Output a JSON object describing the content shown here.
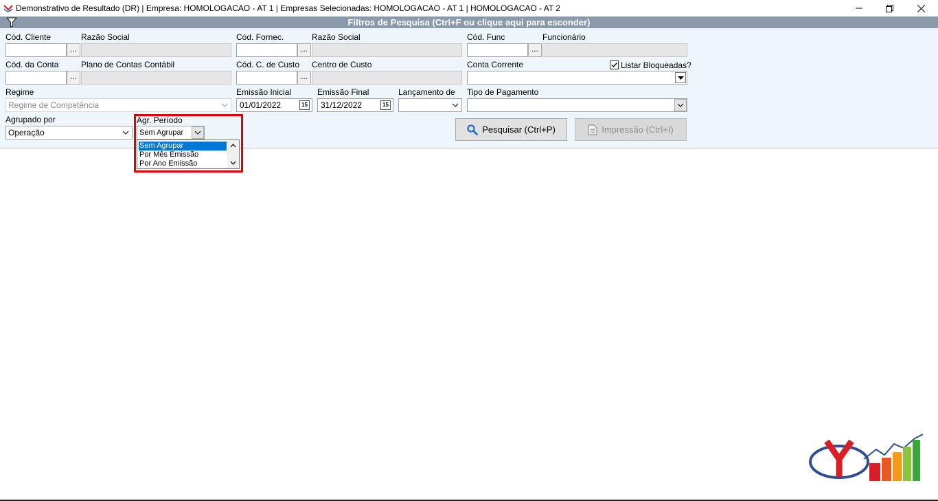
{
  "window": {
    "title": "Demonstrativo de Resultado (DR) | Empresa: HOMOLOGACAO - AT 1 | Empresas Selecionadas: HOMOLOGACAO - AT 1 | HOMOLOGACAO - AT 2"
  },
  "filters": {
    "header": "Filtros de Pesquisa (Ctrl+F ou clique aqui para esconder)",
    "row1": {
      "cod_cliente_label": "Cód. Cliente",
      "razao_social_label": "Razão Social",
      "cod_fornec_label": "Cód. Fornec.",
      "razao_social2_label": "Razão Social",
      "cod_func_label": "Cód. Func",
      "funcionario_label": "Funcionário"
    },
    "row2": {
      "cod_conta_label": "Cód. da Conta",
      "plano_contas_label": "Plano de Contas Contábil",
      "cod_c_custo_label": "Cód. C. de Custo",
      "centro_custo_label": "Centro de Custo",
      "conta_corrente_label": "Conta Corrente",
      "listar_bloqueadas_label": "Listar Bloqueadas?",
      "listar_bloqueadas_checked": true
    },
    "row3": {
      "regime_label": "Regime",
      "regime_value": "Regime de Competência",
      "emissao_inicial_label": "Emissão Inicial",
      "emissao_inicial_value": "01/01/2022",
      "emissao_final_label": "Emissão Final",
      "emissao_final_value": "31/12/2022",
      "lancamento_label": "Lançamento de",
      "tipo_pagamento_label": "Tipo de Pagamento",
      "calendar_glyph": "15"
    },
    "row4": {
      "agrupado_label": "Agrupado por",
      "agrupado_value": "Operação",
      "agr_periodo_label": "Agr. Período",
      "agr_periodo_value": "Sem Agrupar",
      "agr_periodo_options": [
        "Sem Agrupar",
        "Por Mês Emissão",
        "Por Ano Emissão"
      ]
    },
    "buttons": {
      "pesquisar": "Pesquisar (Ctrl+P)",
      "impressao": "Impressão (Ctrl+I)"
    },
    "dots": "..."
  },
  "colors": {
    "panel_bg": "#eef5fb",
    "header_bg": "#8a99ab",
    "highlight": "#e00000",
    "selection": "#0078d7"
  }
}
